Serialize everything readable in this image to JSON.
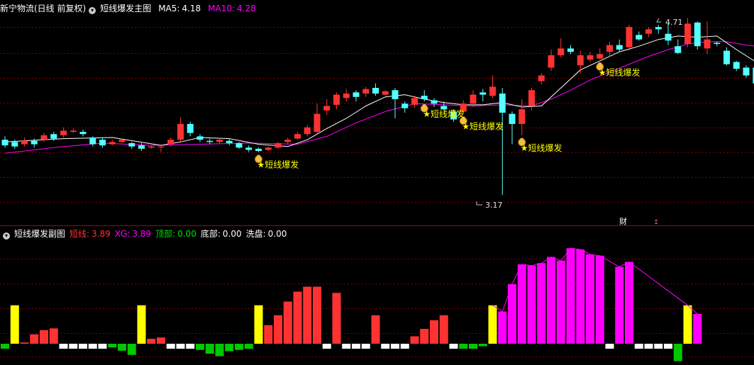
{
  "main_header": {
    "stock_title": "新宁物流(日线 前复权)",
    "indicator_name": "短线爆发主图",
    "ma5_label": "MA5:",
    "ma5_value": "4.18",
    "ma10_label": "MA10:",
    "ma10_value": "4.28"
  },
  "sub_header": {
    "indicator_name": "短线爆发副图",
    "dx_label": "短线:",
    "dx_value": "3.89",
    "xg_label": "XG:",
    "xg_value": "3.89",
    "top_label": "顶部:",
    "top_value": "0.00",
    "bottom_label": "底部:",
    "bottom_value": "0.00",
    "wash_label": "洗盘:",
    "wash_value": "0.00"
  },
  "colors": {
    "bg": "#000000",
    "up": "#ff3232",
    "down": "#54ffff",
    "ma5": "#ffffff",
    "ma10": "#ff00ff",
    "signal": "#ffff00",
    "grid": "#800000",
    "neutral_bar": "#ffffff",
    "green_bar": "#00c800"
  },
  "chart_data": [
    {
      "type": "candlestick",
      "price_range": [
        2.9,
        4.9
      ],
      "high_annotation": "4.71",
      "low_annotation": "3.17",
      "signal_label": "★短线爆发",
      "marker_text": "财",
      "ohlc": [
        [
          3.66,
          3.61,
          3.69,
          3.59
        ],
        [
          3.64,
          3.6,
          3.66,
          3.58
        ],
        [
          3.62,
          3.65,
          3.68,
          3.6
        ],
        [
          3.65,
          3.62,
          3.67,
          3.59
        ],
        [
          3.66,
          3.7,
          3.72,
          3.64
        ],
        [
          3.71,
          3.67,
          3.73,
          3.65
        ],
        [
          3.7,
          3.74,
          3.77,
          3.68
        ],
        [
          3.73,
          3.74,
          3.76,
          3.72
        ],
        [
          3.73,
          3.71,
          3.75,
          3.69
        ],
        [
          3.68,
          3.62,
          3.69,
          3.6
        ],
        [
          3.66,
          3.61,
          3.68,
          3.59
        ],
        [
          3.62,
          3.64,
          3.66,
          3.61
        ],
        [
          3.64,
          3.66,
          3.67,
          3.63
        ],
        [
          3.63,
          3.6,
          3.64,
          3.58
        ],
        [
          3.61,
          3.58,
          3.63,
          3.56
        ],
        [
          3.59,
          3.6,
          3.61,
          3.58
        ],
        [
          3.6,
          3.6,
          3.61,
          3.55
        ],
        [
          3.62,
          3.66,
          3.68,
          3.6
        ],
        [
          3.66,
          3.8,
          3.86,
          3.64
        ],
        [
          3.8,
          3.72,
          3.82,
          3.69
        ],
        [
          3.69,
          3.66,
          3.71,
          3.64
        ],
        [
          3.65,
          3.64,
          3.67,
          3.62
        ],
        [
          3.64,
          3.66,
          3.68,
          3.62
        ],
        [
          3.65,
          3.63,
          3.67,
          3.61
        ],
        [
          3.63,
          3.59,
          3.64,
          3.58
        ],
        [
          3.59,
          3.57,
          3.61,
          3.55
        ],
        [
          3.58,
          3.56,
          3.59,
          3.55
        ],
        [
          3.57,
          3.59,
          3.6,
          3.56
        ],
        [
          3.59,
          3.63,
          3.64,
          3.58
        ],
        [
          3.64,
          3.66,
          3.68,
          3.62
        ],
        [
          3.67,
          3.71,
          3.73,
          3.66
        ],
        [
          3.71,
          3.77,
          3.79,
          3.69
        ],
        [
          3.73,
          3.89,
          3.98,
          3.71
        ],
        [
          3.92,
          3.96,
          4.02,
          3.88
        ],
        [
          3.97,
          4.06,
          4.08,
          3.93
        ],
        [
          4.03,
          4.07,
          4.11,
          4.0
        ],
        [
          4.08,
          4.04,
          4.1,
          4.0
        ],
        [
          4.07,
          4.11,
          4.13,
          4.04
        ],
        [
          4.12,
          4.07,
          4.16,
          4.05
        ],
        [
          4.06,
          4.09,
          4.1,
          4.05
        ],
        [
          4.1,
          4.02,
          4.12,
          3.85
        ],
        [
          3.98,
          3.94,
          4.0,
          3.9
        ],
        [
          3.97,
          4.03,
          4.05,
          3.94
        ],
        [
          4.05,
          4.02,
          4.1,
          4.0
        ],
        [
          4.01,
          3.98,
          4.03,
          3.95
        ],
        [
          3.96,
          3.93,
          4.0,
          3.92
        ],
        [
          3.91,
          3.84,
          3.93,
          3.82
        ],
        [
          3.91,
          3.98,
          4.01,
          3.89
        ],
        [
          3.98,
          4.06,
          4.1,
          3.95
        ],
        [
          4.08,
          4.06,
          4.11,
          4.0
        ],
        [
          4.05,
          4.13,
          4.23,
          4.03
        ],
        [
          4.07,
          3.9,
          4.12,
          3.17
        ],
        [
          3.89,
          3.8,
          3.91,
          3.62
        ],
        [
          3.8,
          3.93,
          4.02,
          3.7
        ],
        [
          3.96,
          4.1,
          4.12,
          3.92
        ],
        [
          4.18,
          4.23,
          4.25,
          4.15
        ],
        [
          4.3,
          4.41,
          4.46,
          4.27
        ],
        [
          4.41,
          4.47,
          4.56,
          4.39
        ],
        [
          4.47,
          4.44,
          4.5,
          4.42
        ],
        [
          4.32,
          4.41,
          4.45,
          4.25
        ],
        [
          4.37,
          4.41,
          4.44,
          4.35
        ],
        [
          4.38,
          4.42,
          4.47,
          4.37
        ],
        [
          4.44,
          4.5,
          4.53,
          4.4
        ],
        [
          4.5,
          4.46,
          4.55,
          4.44
        ],
        [
          4.48,
          4.66,
          4.68,
          4.45
        ],
        [
          4.59,
          4.55,
          4.62,
          4.54
        ],
        [
          4.6,
          4.64,
          4.66,
          4.57
        ],
        [
          4.66,
          4.64,
          4.68,
          4.6
        ],
        [
          4.6,
          4.54,
          4.69,
          4.5
        ],
        [
          4.49,
          4.43,
          4.55,
          4.42
        ],
        [
          4.51,
          4.69,
          4.74,
          4.48
        ],
        [
          4.7,
          4.49,
          4.71,
          4.46
        ],
        [
          4.47,
          4.55,
          4.71,
          4.42
        ],
        [
          4.52,
          4.51,
          4.53,
          4.49
        ],
        [
          4.45,
          4.33,
          4.48,
          4.32
        ],
        [
          4.35,
          4.29,
          4.36,
          4.27
        ],
        [
          4.3,
          4.23,
          4.32,
          4.21
        ],
        [
          4.3,
          4.16,
          4.31,
          4.12
        ],
        [
          4.22,
          4.59,
          4.66,
          4.13
        ],
        [
          4.55,
          4.68,
          4.77,
          4.53
        ]
      ],
      "ma5": [
        [
          0,
          3.64
        ],
        [
          6,
          3.67
        ],
        [
          11,
          3.68
        ],
        [
          16,
          3.61
        ],
        [
          18,
          3.64
        ],
        [
          20,
          3.68
        ],
        [
          23,
          3.67
        ],
        [
          26,
          3.62
        ],
        [
          29,
          3.6
        ],
        [
          31,
          3.66
        ],
        [
          33,
          3.76
        ],
        [
          35,
          3.85
        ],
        [
          37,
          3.96
        ],
        [
          39,
          4.04
        ],
        [
          41,
          4.06
        ],
        [
          43,
          4.02
        ],
        [
          45,
          3.99
        ],
        [
          47,
          3.97
        ],
        [
          49,
          3.97
        ],
        [
          51,
          3.99
        ],
        [
          53,
          3.95
        ],
        [
          55,
          3.96
        ],
        [
          57,
          4.12
        ],
        [
          59,
          4.28
        ],
        [
          61,
          4.36
        ],
        [
          63,
          4.44
        ],
        [
          65,
          4.49
        ],
        [
          67,
          4.55
        ],
        [
          69,
          4.58
        ],
        [
          71,
          4.57
        ],
        [
          73,
          4.58
        ],
        [
          75,
          4.46
        ],
        [
          77,
          4.35
        ],
        [
          78,
          4.3
        ],
        [
          79,
          4.39
        ]
      ],
      "ma10": [
        [
          0,
          3.54
        ],
        [
          5,
          3.59
        ],
        [
          10,
          3.63
        ],
        [
          15,
          3.61
        ],
        [
          20,
          3.62
        ],
        [
          25,
          3.63
        ],
        [
          30,
          3.62
        ],
        [
          33,
          3.69
        ],
        [
          36,
          3.81
        ],
        [
          39,
          3.91
        ],
        [
          42,
          3.98
        ],
        [
          45,
          3.97
        ],
        [
          48,
          3.96
        ],
        [
          51,
          3.97
        ],
        [
          54,
          3.96
        ],
        [
          56,
          4.02
        ],
        [
          58,
          4.1
        ],
        [
          60,
          4.19
        ],
        [
          62,
          4.26
        ],
        [
          64,
          4.33
        ],
        [
          66,
          4.4
        ],
        [
          68,
          4.46
        ],
        [
          70,
          4.51
        ],
        [
          72,
          4.53
        ],
        [
          74,
          4.53
        ],
        [
          76,
          4.5
        ],
        [
          78,
          4.48
        ],
        [
          79,
          4.49
        ]
      ],
      "signals": [
        26,
        43,
        47,
        53,
        61
      ],
      "fist_markers": [
        26,
        43,
        47,
        53,
        61
      ]
    },
    {
      "type": "bar",
      "value_range": [
        -0.6,
        4.6
      ],
      "values": [
        [
          -0.2,
          "green"
        ],
        [
          1.55,
          "yellow"
        ],
        [
          0.05,
          "red"
        ],
        [
          0.38,
          "red"
        ],
        [
          0.55,
          "red"
        ],
        [
          0.62,
          "red"
        ],
        [
          -0.2,
          "white"
        ],
        [
          -0.2,
          "white"
        ],
        [
          -0.2,
          "white"
        ],
        [
          -0.2,
          "white"
        ],
        [
          -0.2,
          "white"
        ],
        [
          -0.15,
          "green"
        ],
        [
          -0.28,
          "green"
        ],
        [
          -0.45,
          "green"
        ],
        [
          1.55,
          "yellow"
        ],
        [
          0.2,
          "red"
        ],
        [
          0.25,
          "red"
        ],
        [
          -0.2,
          "white"
        ],
        [
          -0.2,
          "white"
        ],
        [
          -0.2,
          "white"
        ],
        [
          -0.25,
          "green"
        ],
        [
          -0.4,
          "green"
        ],
        [
          -0.5,
          "green"
        ],
        [
          -0.3,
          "green"
        ],
        [
          -0.25,
          "green"
        ],
        [
          -0.2,
          "green"
        ],
        [
          1.55,
          "yellow"
        ],
        [
          0.75,
          "red"
        ],
        [
          1.15,
          "red"
        ],
        [
          1.7,
          "red"
        ],
        [
          2.1,
          "red"
        ],
        [
          2.3,
          "red"
        ],
        [
          2.3,
          "red"
        ],
        [
          -0.2,
          "white"
        ],
        [
          2.05,
          "red"
        ],
        [
          -0.2,
          "white"
        ],
        [
          -0.2,
          "white"
        ],
        [
          -0.2,
          "white"
        ],
        [
          1.15,
          "red"
        ],
        [
          -0.2,
          "white"
        ],
        [
          -0.2,
          "white"
        ],
        [
          -0.2,
          "white"
        ],
        [
          0.3,
          "red"
        ],
        [
          0.6,
          "red"
        ],
        [
          0.95,
          "red"
        ],
        [
          1.15,
          "red"
        ],
        [
          -0.2,
          "white"
        ],
        [
          -0.2,
          "green"
        ],
        [
          -0.2,
          "green"
        ],
        [
          -0.1,
          "green"
        ],
        [
          1.55,
          "yellow"
        ],
        [
          1.3,
          "magenta"
        ],
        [
          2.4,
          "magenta"
        ],
        [
          3.2,
          "magenta"
        ],
        [
          3.15,
          "magenta"
        ],
        [
          3.25,
          "magenta"
        ],
        [
          3.5,
          "magenta"
        ],
        [
          3.35,
          "magenta"
        ],
        [
          3.85,
          "magenta"
        ],
        [
          3.8,
          "magenta"
        ],
        [
          3.6,
          "magenta"
        ],
        [
          3.55,
          "magenta"
        ],
        [
          -0.2,
          "white"
        ],
        [
          3.1,
          "magenta"
        ],
        [
          3.3,
          "magenta"
        ],
        [
          -0.2,
          "white"
        ],
        [
          -0.2,
          "white"
        ],
        [
          -0.2,
          "white"
        ],
        [
          -0.2,
          "white"
        ],
        [
          -0.7,
          "green"
        ],
        [
          1.55,
          "yellow"
        ],
        [
          1.2,
          "magenta"
        ]
      ]
    }
  ]
}
